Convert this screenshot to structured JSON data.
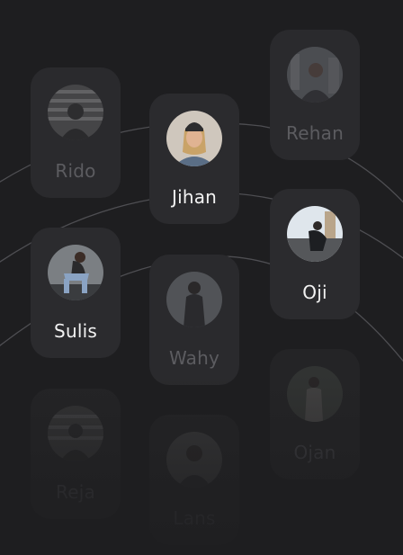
{
  "people": [
    {
      "name": "Rido",
      "icon": "person-photo-striped",
      "state": "dim"
    },
    {
      "name": "Jihan",
      "icon": "person-photo-beanie",
      "state": "active"
    },
    {
      "name": "Rehan",
      "icon": "person-photo-city",
      "state": "dim"
    },
    {
      "name": "Sulis",
      "icon": "person-photo-sitting",
      "state": "active"
    },
    {
      "name": "Oji",
      "icon": "person-photo-crouching",
      "state": "active"
    },
    {
      "name": "Wahy",
      "icon": "person-photo-standing",
      "state": "dim"
    },
    {
      "name": "Reja",
      "icon": "person-photo-striped",
      "state": "faint"
    },
    {
      "name": "Lans",
      "icon": "person-photo-portrait",
      "state": "faint"
    },
    {
      "name": "Ojan",
      "icon": "person-photo-outdoor",
      "state": "faint"
    }
  ],
  "colors": {
    "background": "#1e1e20",
    "card": "#2a2a2d",
    "name_active": "#f2f2f2",
    "name_dim": "#5c5c60",
    "arc": "#5a5a5e"
  }
}
